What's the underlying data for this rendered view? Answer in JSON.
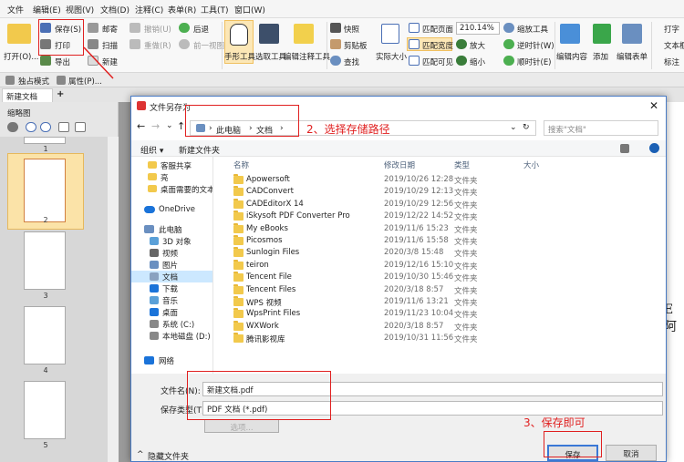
{
  "menu": [
    "文件",
    "编辑(E)",
    "视图(V)",
    "文档(D)",
    "注释(C)",
    "表单(R)",
    "工具(T)",
    "窗口(W)"
  ],
  "ribbon": {
    "open": "打开(O)...",
    "save": "保存(S)",
    "print": "打印",
    "export": "导出",
    "mail": "邮寄",
    "scan": "扫描",
    "new": "新建",
    "undo": "撤销(U)",
    "redo": "重做(R)",
    "back": "后退",
    "prev_view": "前一视图",
    "hand_tool": "手形工具",
    "select_tool": "选取工具",
    "annot_tool": "编辑注释工具",
    "snapshot": "快照",
    "clipboard": "剪贴板",
    "find": "查找",
    "actual_size": "实际大小",
    "fit_page": "匹配页面",
    "fit_width": "匹配宽度",
    "fit_visible": "匹配可见",
    "zoom": "210.14%",
    "zoom_in": "放大",
    "zoom_out": "缩小",
    "zoom_tool": "缩放工具",
    "rotate_ccw": "逆时针(W)",
    "rotate_cw": "顺时针(E)",
    "edit_content": "编辑内容",
    "add": "添加",
    "edit_form": "编辑表单",
    "typewriter": "打字",
    "textbox": "文本框",
    "callout": "标注"
  },
  "secondary": {
    "exclusive": "独占模式",
    "properties": "属性(P)..."
  },
  "tab": {
    "name": "新建文档"
  },
  "left_panel": {
    "title": "缩略图",
    "pages": [
      "1",
      "2",
      "3",
      "4",
      "5"
    ]
  },
  "dialog": {
    "title": "文件另存为",
    "path": [
      "此电脑",
      "文档"
    ],
    "search_placeholder": "搜索\"文档\"",
    "organize": "组织 ▾",
    "new_folder": "新建文件夹",
    "columns": [
      "名称",
      "修改日期",
      "类型",
      "大小"
    ],
    "tree": [
      {
        "label": "客服共享"
      },
      {
        "label": "亮"
      },
      {
        "label": "桌面需要的文本"
      },
      {
        "label": "OneDrive"
      },
      {
        "label": "此电脑"
      },
      {
        "label": "3D 对象"
      },
      {
        "label": "视频"
      },
      {
        "label": "图片"
      },
      {
        "label": "文档"
      },
      {
        "label": "下载"
      },
      {
        "label": "音乐"
      },
      {
        "label": "桌面"
      },
      {
        "label": "系统 (C:)"
      },
      {
        "label": "本地磁盘 (D:)"
      },
      {
        "label": "网络"
      }
    ],
    "files": [
      {
        "name": "Apowersoft",
        "date": "2019/10/26 12:28",
        "type": "文件夹"
      },
      {
        "name": "CADConvert",
        "date": "2019/10/29 12:13",
        "type": "文件夹"
      },
      {
        "name": "CADEditorX 14",
        "date": "2019/10/29 12:56",
        "type": "文件夹"
      },
      {
        "name": "iSkysoft PDF Converter Pro",
        "date": "2019/12/22 14:52",
        "type": "文件夹"
      },
      {
        "name": "My eBooks",
        "date": "2019/11/6 15:23",
        "type": "文件夹"
      },
      {
        "name": "Picosmos",
        "date": "2019/11/6 15:58",
        "type": "文件夹"
      },
      {
        "name": "Sunlogin Files",
        "date": "2020/3/8 15:48",
        "type": "文件夹"
      },
      {
        "name": "teiron",
        "date": "2019/12/16 15:10",
        "type": "文件夹"
      },
      {
        "name": "Tencent File",
        "date": "2019/10/30 15:46",
        "type": "文件夹"
      },
      {
        "name": "Tencent Files",
        "date": "2020/3/18 8:57",
        "type": "文件夹"
      },
      {
        "name": "WPS 视频",
        "date": "2019/11/6 13:21",
        "type": "文件夹"
      },
      {
        "name": "WpsPrint Files",
        "date": "2019/11/23 10:04",
        "type": "文件夹"
      },
      {
        "name": "WXWork",
        "date": "2020/3/18 8:57",
        "type": "文件夹"
      },
      {
        "name": "腾讯影视库",
        "date": "2019/10/31 11:56",
        "type": "文件夹"
      }
    ],
    "filename_label": "文件名(N):",
    "filename": "新建文档.pdf",
    "filetype_label": "保存类型(T):",
    "filetype": "PDF 文档 (*.pdf)",
    "options": "选项...",
    "hide_folders": "隐藏文件夹",
    "save": "保存",
    "cancel": "取消"
  },
  "annotations": {
    "step2": "2、选择存储路径",
    "step3": "3、保存即可"
  },
  "doc_fragment": "E阿"
}
